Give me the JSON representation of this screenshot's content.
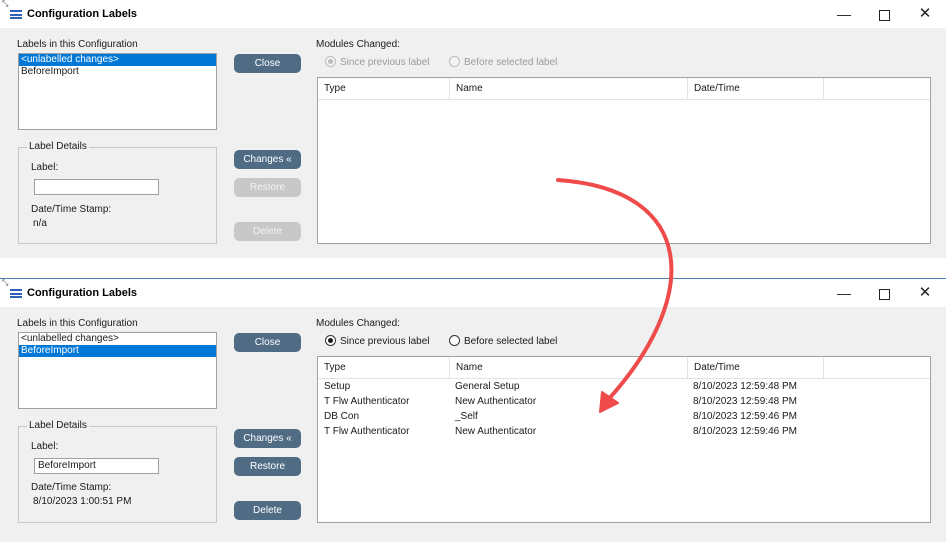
{
  "windows": {
    "before": {
      "title": "Configuration Labels",
      "labels_heading": "Labels in this Configuration",
      "labels": [
        {
          "text": "<unlabelled changes>",
          "selected": true
        },
        {
          "text": "BeforeImport",
          "selected": false
        }
      ],
      "label_details_legend": "Label Details",
      "label_caption": "Label:",
      "label_value": "",
      "datetime_caption": "Date/Time Stamp:",
      "datetime_value": "n/a",
      "buttons": {
        "close": "Close",
        "changes": "Changes «",
        "restore": "Restore",
        "delete": "Delete"
      },
      "modules_heading": "Modules Changed:",
      "radio_since": "Since previous label",
      "radio_before": "Before selected label",
      "columns": [
        "Type",
        "Name",
        "Date/Time"
      ],
      "rows": []
    },
    "after": {
      "title": "Configuration Labels",
      "labels_heading": "Labels in this Configuration",
      "labels": [
        {
          "text": "<unlabelled changes>",
          "selected": false
        },
        {
          "text": "BeforeImport",
          "selected": true
        }
      ],
      "label_details_legend": "Label Details",
      "label_caption": "Label:",
      "label_value": "BeforeImport",
      "datetime_caption": "Date/Time Stamp:",
      "datetime_value": "8/10/2023 1:00:51 PM",
      "buttons": {
        "close": "Close",
        "changes": "Changes «",
        "restore": "Restore",
        "delete": "Delete"
      },
      "modules_heading": "Modules Changed:",
      "radio_since": "Since previous label",
      "radio_before": "Before selected label",
      "columns": [
        "Type",
        "Name",
        "Date/Time"
      ],
      "rows": [
        {
          "type": "Setup",
          "name": "General Setup",
          "datetime": "8/10/2023 12:59:48 PM"
        },
        {
          "type": "T Flw Authenticator",
          "name": "New Authenticator",
          "datetime": "8/10/2023 12:59:48 PM"
        },
        {
          "type": "DB Con",
          "name": "_Self",
          "datetime": "8/10/2023 12:59:46 PM"
        },
        {
          "type": "T Flw Authenticator",
          "name": "New Authenticator",
          "datetime": "8/10/2023 12:59:46 PM"
        }
      ]
    }
  },
  "window_controls": {
    "minimize": "—",
    "close": "✕"
  },
  "icons": {
    "app": "menu-lines-icon",
    "arrow": "curved-arrow-annotation"
  },
  "colors": {
    "accent": "#0078d7",
    "button": "#4f6c84",
    "arrow": "#ef4b4b"
  }
}
